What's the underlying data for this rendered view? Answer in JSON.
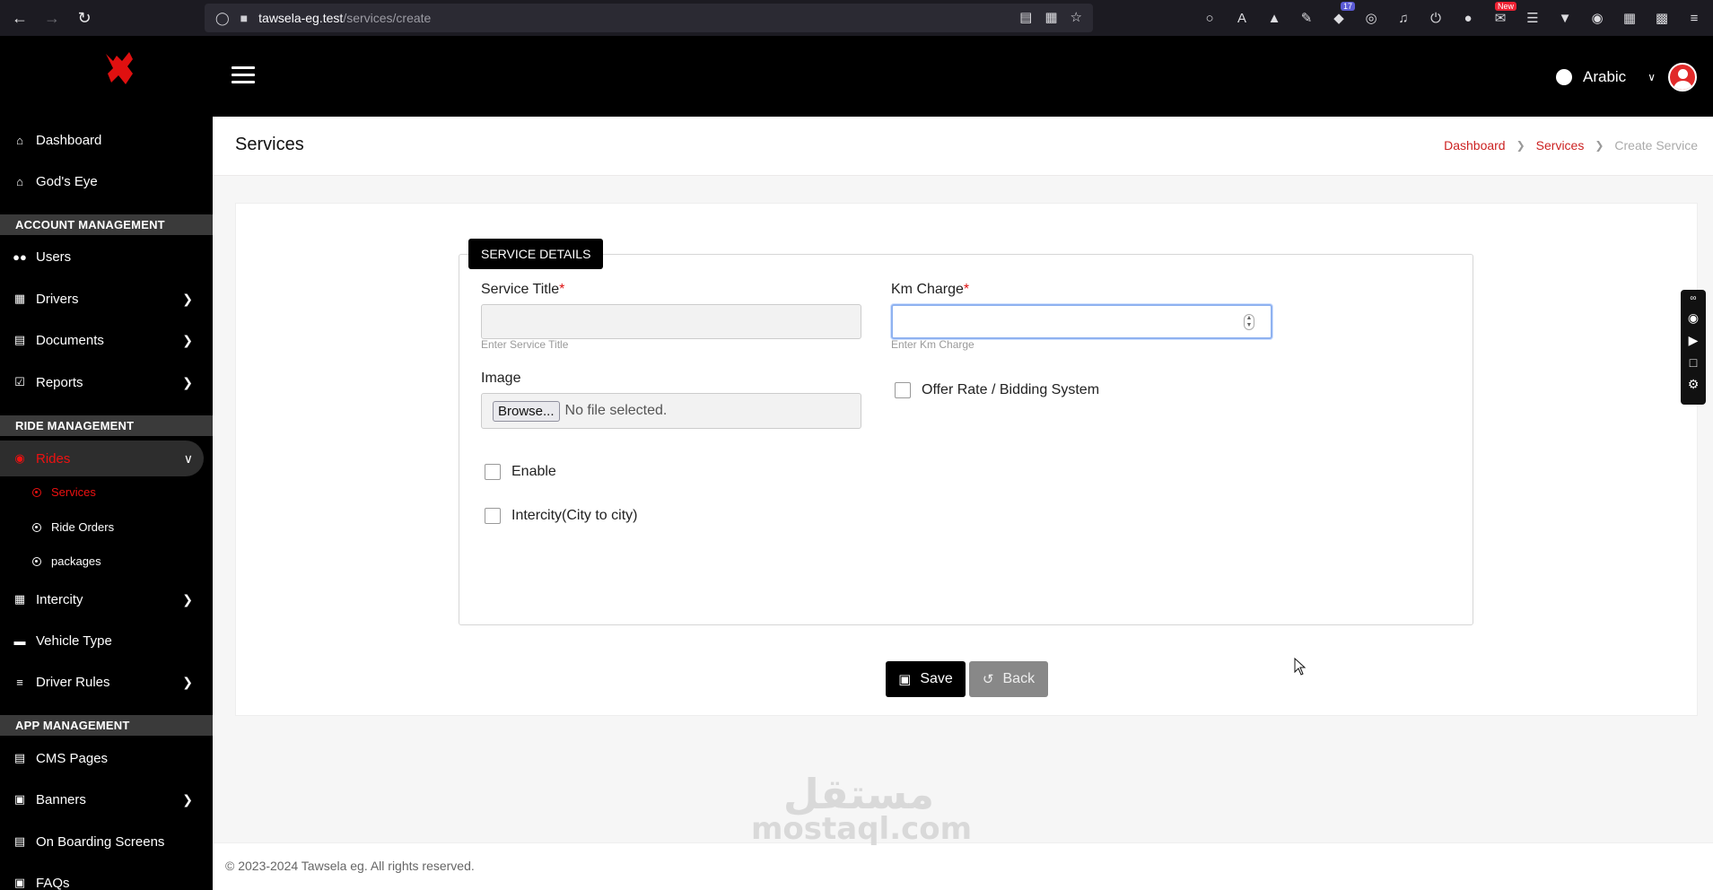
{
  "browser": {
    "url_host": "tawsela-eg.test",
    "url_path": "/services/create",
    "extension_badges": {
      "notifications": "17",
      "new": "New"
    }
  },
  "header": {
    "language": "Arabic"
  },
  "sidebar": {
    "items_top": [
      {
        "label": "Dashboard",
        "icon": "home-icon"
      },
      {
        "label": "God's Eye",
        "icon": "eye-icon"
      }
    ],
    "sections": [
      {
        "label": "ACCOUNT MANAGEMENT"
      },
      {
        "label": "RIDE MANAGEMENT"
      },
      {
        "label": "APP MANAGEMENT"
      }
    ],
    "account_items": [
      {
        "label": "Users"
      },
      {
        "label": "Drivers"
      },
      {
        "label": "Documents"
      },
      {
        "label": "Reports"
      }
    ],
    "ride_items": [
      {
        "label": "Rides"
      },
      {
        "label": "Intercity"
      },
      {
        "label": "Vehicle Type"
      },
      {
        "label": "Driver Rules"
      }
    ],
    "ride_sub_items": [
      {
        "label": "Services"
      },
      {
        "label": "Ride Orders"
      },
      {
        "label": "packages"
      }
    ],
    "app_items": [
      {
        "label": "CMS Pages"
      },
      {
        "label": "Banners"
      },
      {
        "label": "On Boarding Screens"
      },
      {
        "label": "FAQs"
      }
    ]
  },
  "page": {
    "title": "Services",
    "breadcrumb": [
      "Dashboard",
      "Services",
      "Create Service"
    ]
  },
  "form": {
    "legend": "SERVICE DETAILS",
    "service_title_label": "Service Title",
    "service_title_value": "",
    "service_title_hint": "Enter Service Title",
    "km_charge_label": "Km Charge",
    "km_charge_value": "",
    "km_charge_hint": "Enter Km Charge",
    "required_mark": "*",
    "image_label": "Image",
    "browse_label": "Browse...",
    "file_status": "No file selected.",
    "offer_rate_label": "Offer Rate / Bidding System",
    "enable_label": "Enable",
    "intercity_label": "Intercity(City to city)",
    "save_label": "Save",
    "back_label": "Back"
  },
  "footer": {
    "text": "© 2023-2024 Tawsela eg. All rights reserved."
  },
  "watermark": {
    "arabic": "مستقل",
    "latin": "mostaql.com"
  },
  "colors": {
    "accent_red": "#dd1111",
    "sidebar_bg": "#000000",
    "section_bg": "#3a3a3a"
  }
}
